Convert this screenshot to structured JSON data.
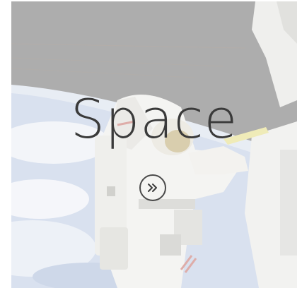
{
  "card": {
    "title": "Space",
    "more_button_icon": "double-chevron-right-icon"
  },
  "colors": {
    "overlay": "#ffffffb0",
    "sky": "#8c8c8c",
    "title": "#3a3a3a"
  }
}
